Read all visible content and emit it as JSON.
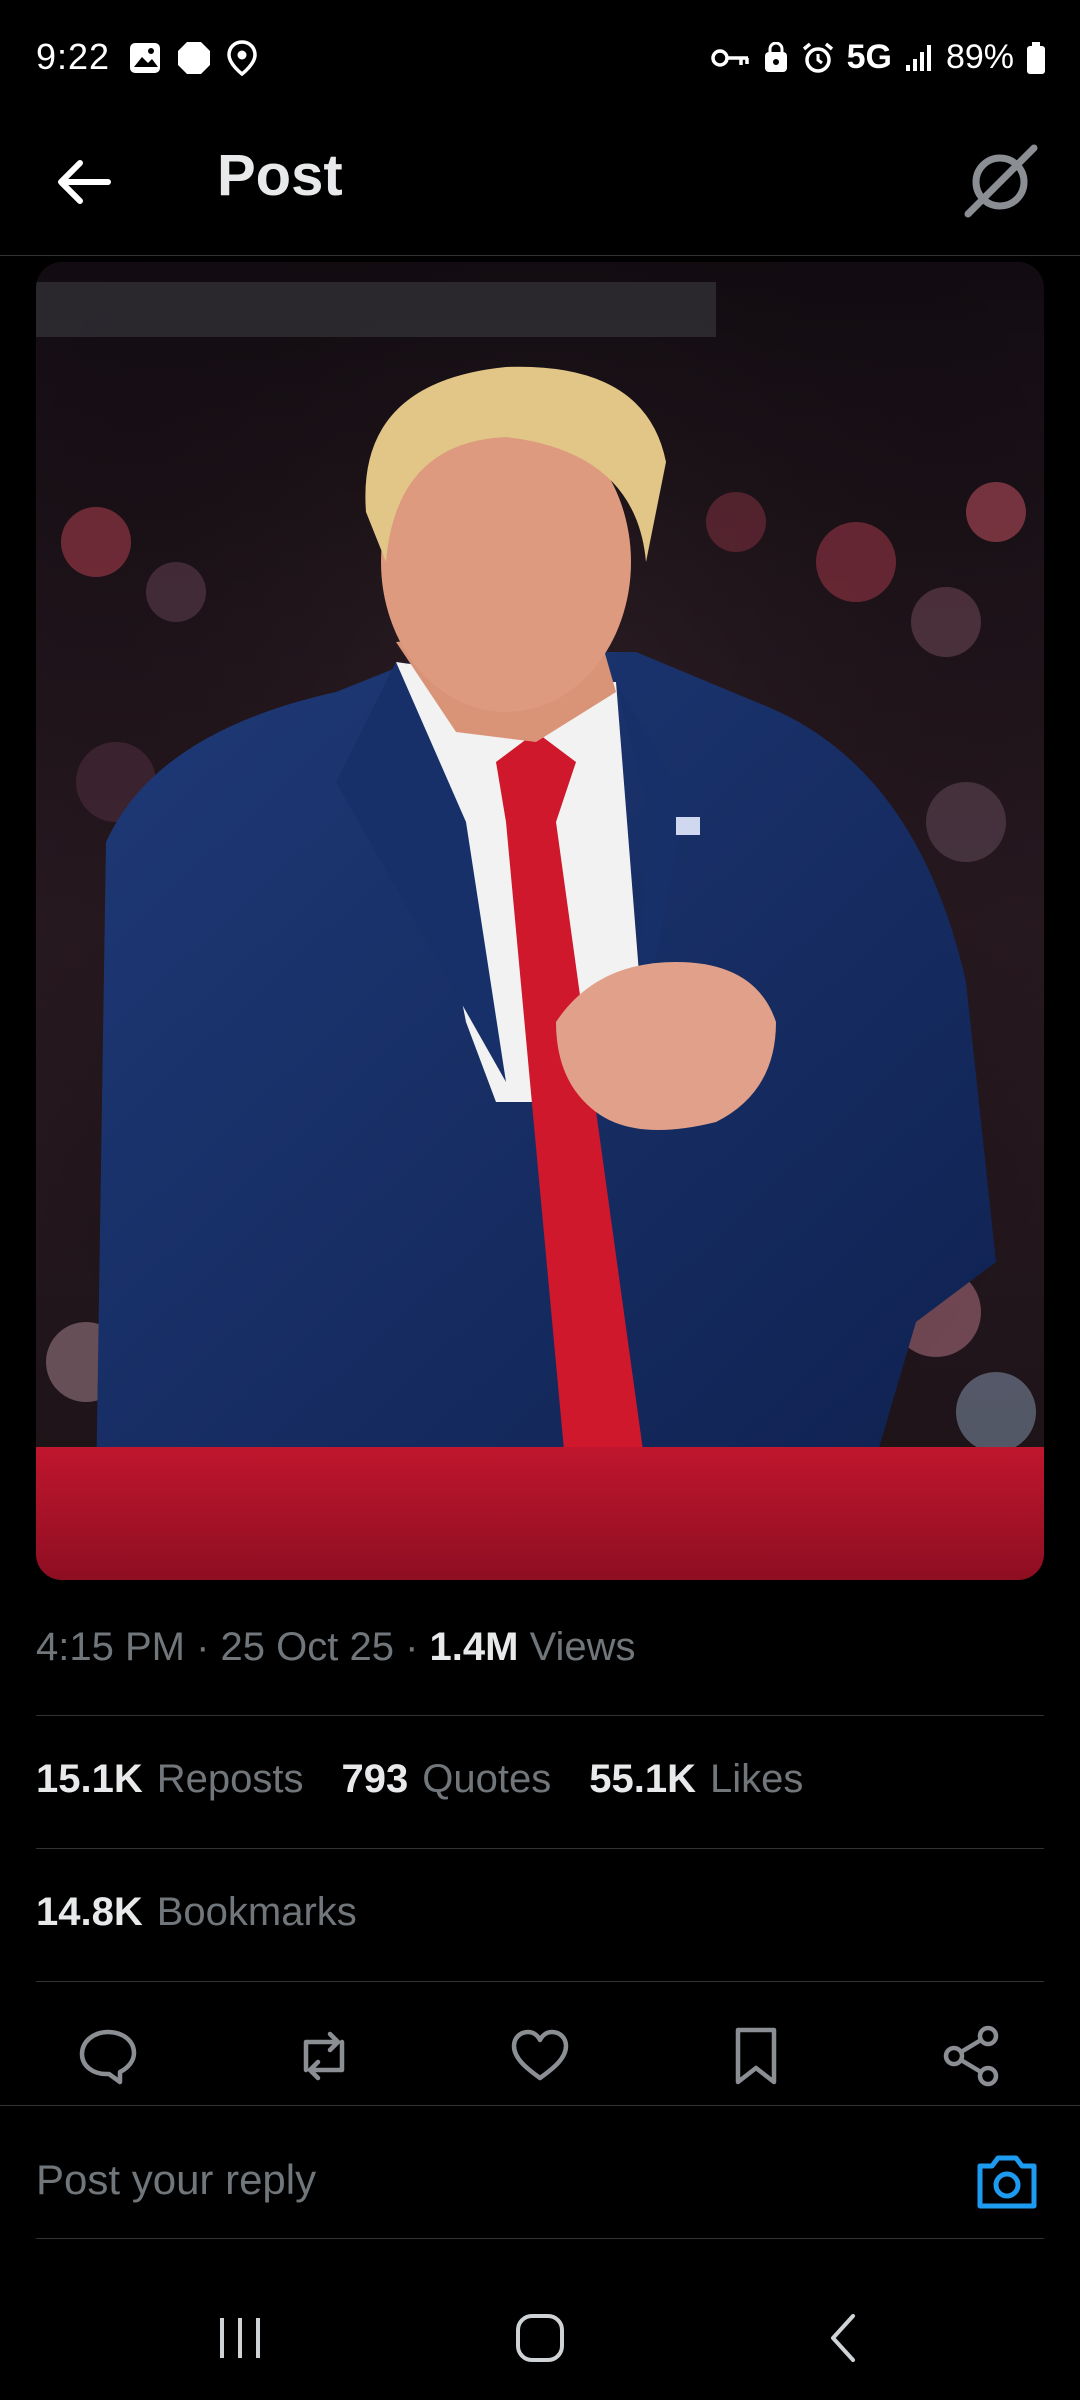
{
  "status_bar": {
    "time": "9:22",
    "network": "5G",
    "battery": "89%"
  },
  "header": {
    "title": "Post"
  },
  "post": {
    "time": "4:15 PM",
    "date": "25 Oct 25",
    "views_count": "1.4M",
    "views_label": "Views",
    "reposts_count": "15.1K",
    "reposts_label": "Reposts",
    "quotes_count": "793",
    "quotes_label": "Quotes",
    "likes_count": "55.1K",
    "likes_label": "Likes",
    "bookmarks_count": "14.8K",
    "bookmarks_label": "Bookmarks"
  },
  "reply": {
    "placeholder": "Post your reply"
  },
  "colors": {
    "background": "#000000",
    "muted_text": "#71767b",
    "primary_text": "#e7e9ea",
    "accent": "#1d9bf0"
  }
}
